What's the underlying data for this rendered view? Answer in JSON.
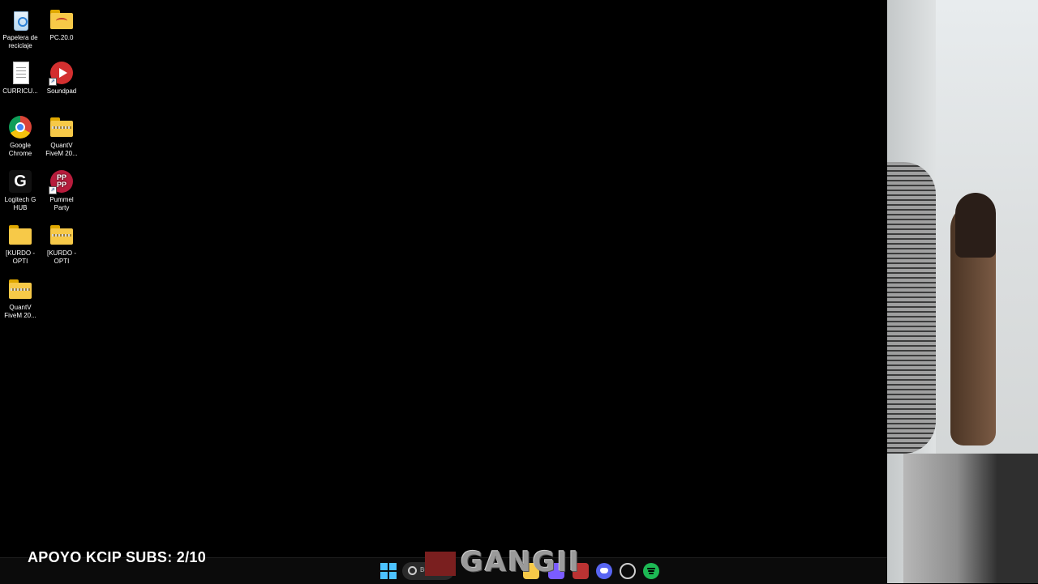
{
  "desktop": {
    "icons": [
      {
        "label": "Papelera de reciclaje",
        "icon": "recycle-bin-icon"
      },
      {
        "label": "PC.20.0",
        "icon": "folder-icon"
      },
      {
        "label": "CURRICU...",
        "icon": "document-icon"
      },
      {
        "label": "Soundpad",
        "icon": "soundpad-icon"
      },
      {
        "label": "Google Chrome",
        "icon": "chrome-icon"
      },
      {
        "label": "QuantV FiveM 20...",
        "icon": "zip-folder-icon"
      },
      {
        "label": "Logitech G HUB",
        "icon": "logitech-icon"
      },
      {
        "label": "Pummel Party",
        "icon": "pummel-party-icon"
      },
      {
        "label": "[KURDO - OPTI",
        "icon": "folder-icon"
      },
      {
        "label": "[KURDO - OPTI",
        "icon": "zip-folder-icon"
      },
      {
        "label": "QuantV FiveM 20...",
        "icon": "zip-folder-icon"
      }
    ]
  },
  "overlay": {
    "subs_text": "APOYO KCIP SUBS: 2/10",
    "logo_text": "GANGII"
  },
  "taskbar": {
    "search_text": "Bu",
    "apps": [
      "start-icon",
      "search-icon",
      "file-explorer-icon",
      "store-icon",
      "app-icon",
      "discord-icon",
      "steam-icon",
      "spotify-icon"
    ]
  },
  "colors": {
    "desktop_bg": "#000000",
    "taskbar_bg": "#0b0b0b",
    "start_accent": "#4cc2ff",
    "spotify": "#1db954",
    "discord": "#5865f2"
  }
}
